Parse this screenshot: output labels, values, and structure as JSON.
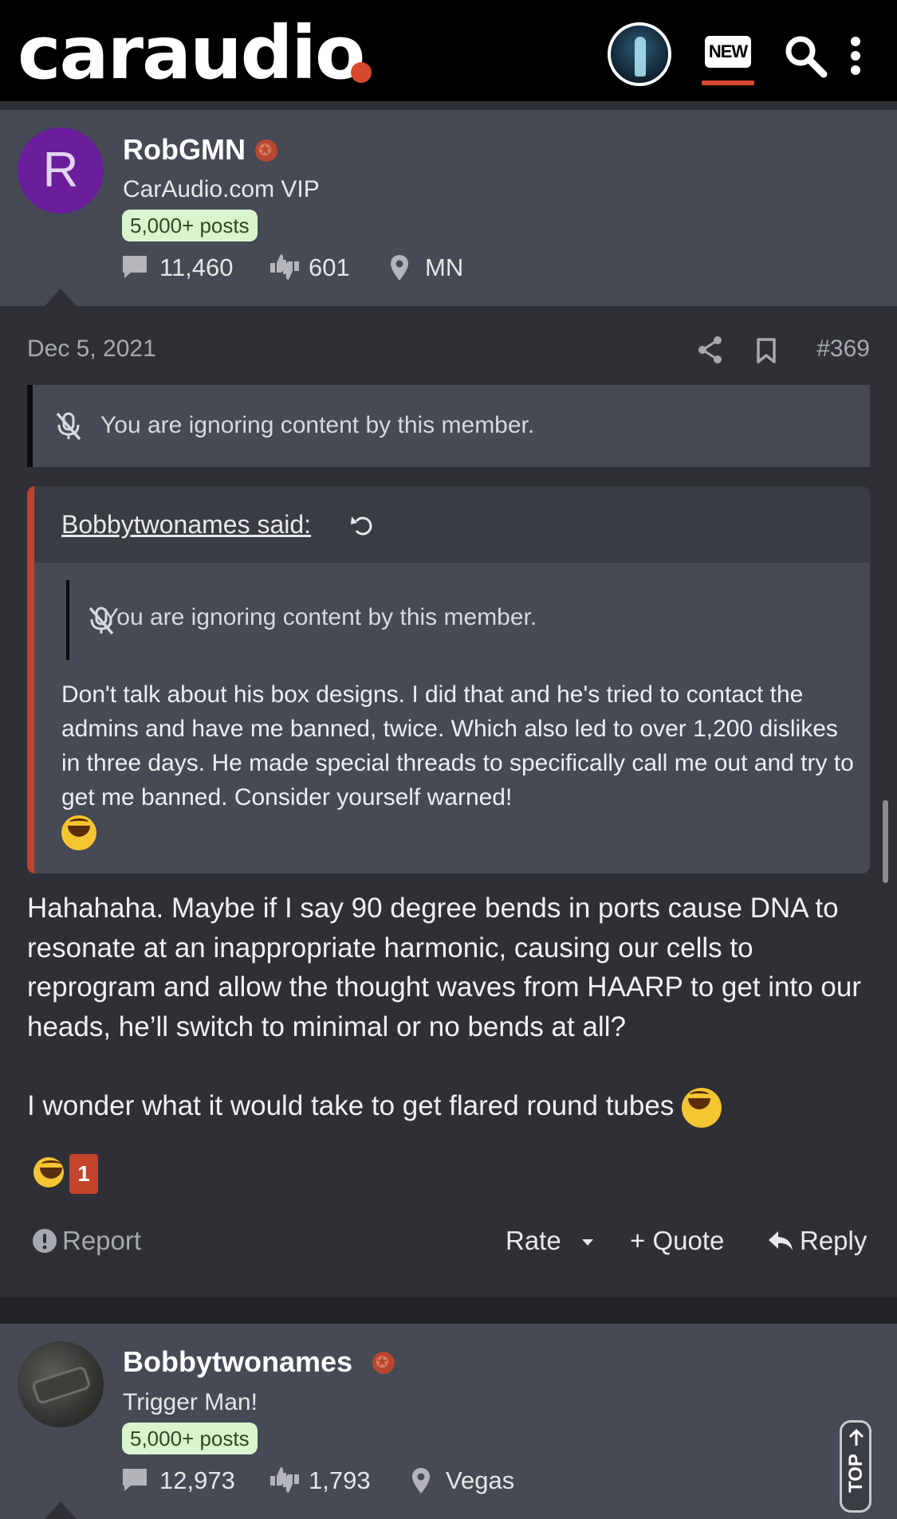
{
  "header": {
    "logo_text": "caraudio",
    "new_label": "NEW",
    "brand_accent": "#d6492e",
    "icons": [
      "user-avatar",
      "new-posts-icon",
      "search-icon",
      "more-vertical-icon"
    ]
  },
  "post": {
    "author": {
      "name": "RobGMN",
      "avatar_letter": "R",
      "title": "CarAudio.com VIP",
      "posts_badge": "5,000+ posts",
      "messages": "11,460",
      "reaction_score": "601",
      "location": "MN"
    },
    "date": "Dec 5, 2021",
    "number": "#369",
    "ignored_notice": "You are ignoring content by this member.",
    "quote": {
      "author": "Bobbytwonames said:",
      "ignored_notice": "You are ignoring content by this member.",
      "body": "Don't talk about his box designs. I did that and he's tried to contact the admins and have me banned, twice. Which also led to over 1,200 dislikes in three days. He made special threads to specifically call me out and try to get me banned. Consider yourself warned!"
    },
    "body_paragraph_1": "Hahahaha. Maybe if I say 90 degree bends in ports cause DNA to resonate at an inappropriate harmonic, causing our cells to reprogram and allow the thought waves from HAARP to get into our heads, he’ll switch to minimal or no bends at all?",
    "body_paragraph_2": "I wonder what it would take to get flared round tubes",
    "reaction_count": "1",
    "actions": {
      "report": "Report",
      "rate": "Rate",
      "quote": "+ Quote",
      "reply": "Reply"
    }
  },
  "next_post": {
    "author": {
      "name": "Bobbytwonames",
      "title": "Trigger Man!",
      "posts_badge": "5,000+ posts",
      "messages": "12,973",
      "reaction_score": "1,793",
      "location": "Vegas"
    }
  },
  "top_button": "TOP"
}
